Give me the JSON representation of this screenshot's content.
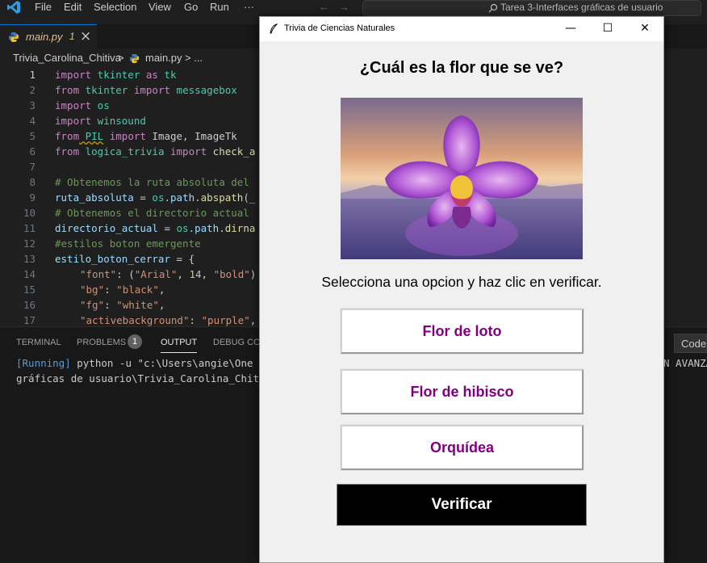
{
  "ide": {
    "menu": [
      "File",
      "Edit",
      "Selection",
      "View",
      "Go",
      "Run",
      "···"
    ],
    "search_text": "Tarea 3-Interfaces gráficas de usuario",
    "tab": {
      "name": "main.py",
      "modified_marker": "1",
      "close": "×"
    },
    "breadcrumb": {
      "folder": "Trivia_Carolina_Chitiva",
      "sep1": ">",
      "file": "main.py",
      "sep2": "> ..."
    },
    "code_lines": [
      {
        "n": "1"
      },
      {
        "n": "2"
      },
      {
        "n": "3"
      },
      {
        "n": "4"
      },
      {
        "n": "5"
      },
      {
        "n": "6"
      },
      {
        "n": "7"
      },
      {
        "n": "8"
      },
      {
        "n": "9"
      },
      {
        "n": "10"
      },
      {
        "n": "11"
      },
      {
        "n": "12"
      },
      {
        "n": "13"
      },
      {
        "n": "14"
      },
      {
        "n": "15"
      },
      {
        "n": "16"
      },
      {
        "n": "17"
      }
    ],
    "code": {
      "l1": [
        "import",
        " tkinter",
        " as",
        " tk"
      ],
      "l2": [
        "from",
        " tkinter",
        " import",
        " messagebox"
      ],
      "l3": [
        "import",
        " os"
      ],
      "l4": [
        "import",
        " winsound"
      ],
      "l5": [
        "from",
        " PIL",
        " import",
        " Image, ImageTk"
      ],
      "l6": [
        "from",
        " logica_trivia",
        " import",
        " check_a"
      ],
      "l8": "# Obtenemos la ruta absoluta del",
      "l9": [
        "ruta_absoluta",
        " = ",
        "os",
        ".",
        "path",
        ".",
        "abspath",
        "(_"
      ],
      "l10": "# Obtenemos el directorio actual",
      "l11": [
        "directorio_actual",
        " = ",
        "os",
        ".",
        "path",
        ".",
        "dirna"
      ],
      "l12": "#estilos boton emergente",
      "l13": [
        "estilo_boton_cerrar",
        " = {"
      ],
      "l14": [
        "\"font\"",
        ": (",
        "\"Arial\"",
        ", ",
        "14",
        ", ",
        "\"bold\"",
        ")"
      ],
      "l15": [
        "\"bg\"",
        ": ",
        "\"black\"",
        ","
      ],
      "l16": [
        "\"fg\"",
        ": ",
        "\"white\"",
        ","
      ],
      "l17": [
        "\"activebackground\"",
        ": ",
        "\"purple\"",
        ","
      ]
    },
    "panel": {
      "tabs": [
        "TERMINAL",
        "PROBLEMS",
        "OUTPUT",
        "DEBUG CON"
      ],
      "problems_count": "1",
      "code_dropdown": "Code",
      "output_line1a": "[Running]",
      "output_line1b": " python -u \"c:\\Users\\angie\\One",
      "output_line1c": "N AVANZA",
      "output_line2": "gráficas de usuario\\Trivia_Carolina_Chit"
    }
  },
  "trivia_window": {
    "title": "Trivia de Ciencias Naturales",
    "controls": {
      "minimize": "—",
      "maximize": "☐",
      "close": "✕"
    },
    "question": "¿Cuál es la flor que se ve?",
    "instruction": "Selecciona una opcion y haz clic en verificar.",
    "options": [
      "Flor de loto",
      "Flor de hibisco",
      "Orquídea"
    ],
    "verify_label": "Verificar",
    "colors": {
      "option_text": "#800080",
      "verify_bg": "#000000",
      "verify_text": "#ffffff"
    }
  }
}
